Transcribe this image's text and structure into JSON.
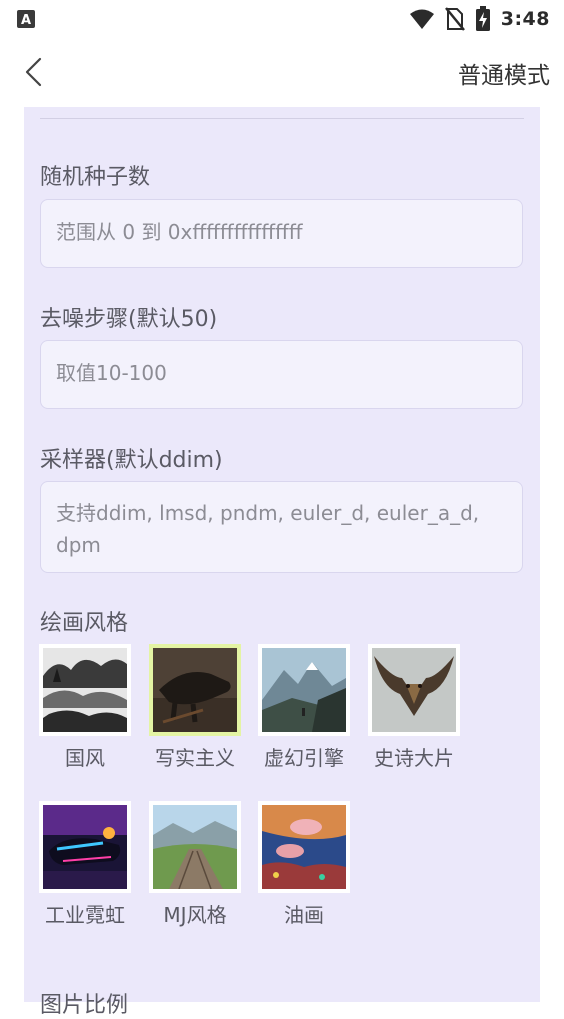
{
  "status_bar": {
    "time": "3:48",
    "notification_badge": "A",
    "icons": [
      "wifi-icon",
      "no-sim-icon",
      "battery-charging-icon"
    ]
  },
  "app_bar": {
    "back_icon": "chevron-left-icon",
    "mode_title": "普通模式"
  },
  "form": {
    "seed": {
      "label": "随机种子数",
      "placeholder": "范围从 0 到 0xffffffffffffffff"
    },
    "steps": {
      "label": "去噪步骤(默认50)",
      "placeholder": "取值10-100"
    },
    "sampler": {
      "label": "采样器(默认ddim)",
      "placeholder": "支持ddim, lmsd, pndm, euler_d, euler_a_d, dpm"
    },
    "style": {
      "label": "绘画风格",
      "selected": "写实主义",
      "options": [
        {
          "name": "国风"
        },
        {
          "name": "写实主义"
        },
        {
          "name": "虚幻引擎"
        },
        {
          "name": "史诗大片"
        },
        {
          "name": "工业霓虹"
        },
        {
          "name": "MJ风格"
        },
        {
          "name": "油画"
        }
      ]
    },
    "ratio": {
      "label": "图片比例"
    }
  },
  "colors": {
    "panel_background": "#ebe8fa",
    "input_background": "#f3f2fc",
    "selected_border": "#e4f4a4"
  }
}
